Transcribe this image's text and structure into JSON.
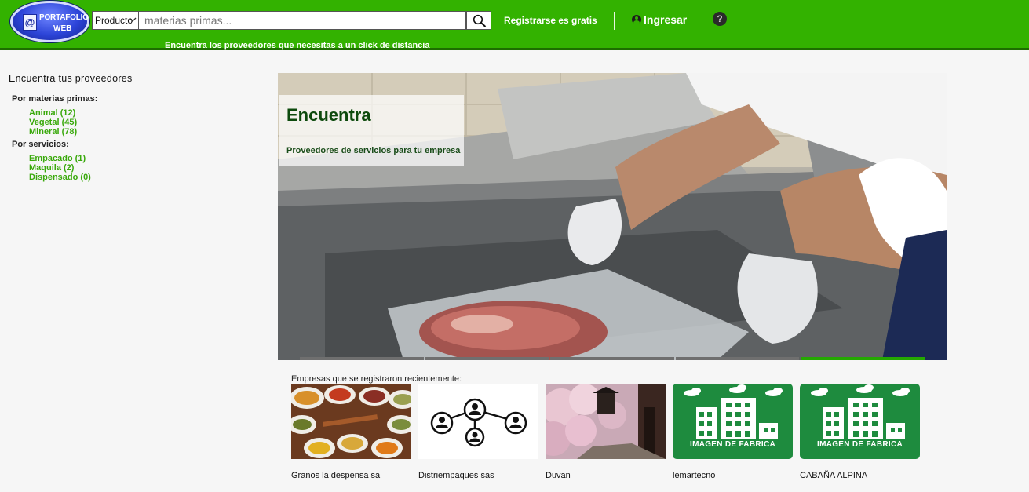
{
  "header": {
    "category_select": "Producto",
    "search_placeholder": "materias primas...",
    "register_label": "Registrarse es gratis",
    "login_label": "Ingresar",
    "help_label": "?",
    "tagline": "Encuentra los proveedores que necesitas a un click de distancia",
    "logo": {
      "line1": "PORTAFOLIO",
      "line2": "WEB",
      "at": "@"
    }
  },
  "sidebar": {
    "title": "Encuentra tus proveedores",
    "groups": [
      {
        "label": "Por materias primas:",
        "items": [
          "Animal (12)",
          "Vegetal (45)",
          "Mineral (78)"
        ]
      },
      {
        "label": "Por servicios:",
        "items": [
          "Empacado (1)",
          "Maquila (2)",
          "Dispensado (0)"
        ]
      }
    ]
  },
  "hero": {
    "title": "Encuentra",
    "subtitle": "Proveedores de servicios para tu empresa",
    "slides": 5,
    "active_slide": 5
  },
  "recent": {
    "title": "Empresas que se registraron recientemente:",
    "companies": [
      {
        "name": "Granos la despensa sa",
        "image": "spices-photo"
      },
      {
        "name": "Distriempaques sas",
        "image": "network-icon"
      },
      {
        "name": "Duvan",
        "image": "cherry-blossom-photo"
      },
      {
        "name": "lemartecno",
        "image": "factory-placeholder",
        "caption": "IMAGEN DE FABRICA"
      },
      {
        "name": "CABAÑA ALPINA",
        "image": "factory-placeholder",
        "caption": "IMAGEN DE FABRICA"
      }
    ]
  },
  "colors": {
    "header_bg": "#33b200",
    "link_green": "#3aa90c",
    "factory_bg": "#1e8b3e",
    "active_dot": "#24a800"
  }
}
